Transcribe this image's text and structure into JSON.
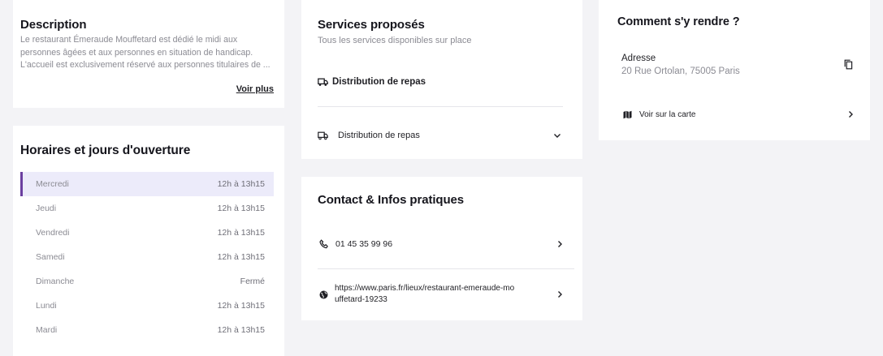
{
  "description": {
    "title": "Description",
    "text": "Le restaurant Émeraude Mouffetard est dédié le midi aux personnes âgées et aux personnes en situation de handicap. L'accueil est exclusivement réservé aux personnes titulaires de ...",
    "more_label": "Voir plus"
  },
  "hours": {
    "title": "Horaires et jours d'ouverture",
    "rows": [
      {
        "day": "Mercredi",
        "time": "12h à 13h15"
      },
      {
        "day": "Jeudi",
        "time": "12h à 13h15"
      },
      {
        "day": "Vendredi",
        "time": "12h à 13h15"
      },
      {
        "day": "Samedi",
        "time": "12h à 13h15"
      },
      {
        "day": "Dimanche",
        "time": "Fermé"
      },
      {
        "day": "Lundi",
        "time": "12h à 13h15"
      },
      {
        "day": "Mardi",
        "time": "12h à 13h15"
      }
    ]
  },
  "services": {
    "title": "Services proposés",
    "subtitle": "Tous les services disponibles sur place",
    "item_label": "Distribution de repas",
    "accordion_label": "Distribution de repas"
  },
  "contact": {
    "title": "Contact & Infos pratiques",
    "phone": "01 45 35 99 96",
    "website_line1": "https://www.paris.fr/lieux/restaurant-emeraude-mo",
    "website_line2": "uffetard-19233"
  },
  "directions": {
    "title": "Comment s'y rendre ?",
    "address_label": "Adresse",
    "address_value": "20 Rue Ortolan, 75005 Paris",
    "map_label": "Voir sur la carte"
  },
  "icons": {
    "truck": "truck-icon",
    "phone": "phone-icon",
    "globe": "globe-icon",
    "copy": "copy-icon",
    "map": "map-icon",
    "chevron_right": "chevron-right-icon",
    "chevron_down": "chevron-down-icon"
  },
  "colors": {
    "accent": "#6b3fa0",
    "active_row_bg": "#ecebfa",
    "page_bg": "#f3f3f6"
  }
}
